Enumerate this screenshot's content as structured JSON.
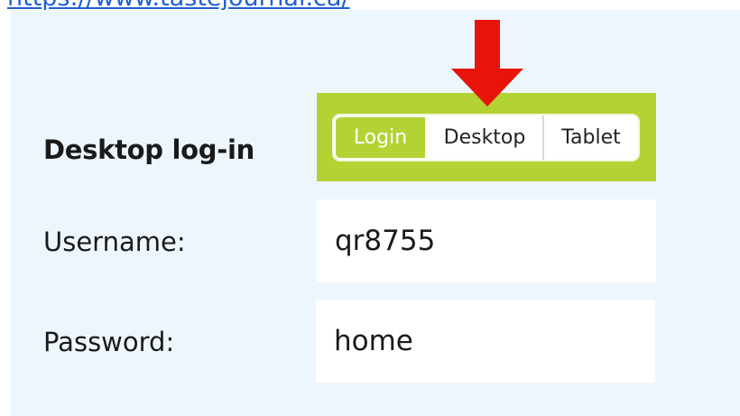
{
  "link": {
    "text": "https://www.tastejournal.ca/"
  },
  "form": {
    "heading": "Desktop log-in",
    "username_label": "Username:",
    "username_value": "qr8755",
    "password_label": "Password:",
    "password_value": "home"
  },
  "toggle": {
    "items": [
      {
        "label": "Login",
        "active": true
      },
      {
        "label": "Desktop",
        "active": false
      },
      {
        "label": "Tablet",
        "active": false
      }
    ]
  },
  "colors": {
    "accent_green": "#b3d334",
    "arrow_red": "#e8140c",
    "panel_bg": "#eef6fd",
    "link_blue": "#1f5fd6"
  },
  "icons": {
    "pointer": "down-arrow-icon"
  }
}
